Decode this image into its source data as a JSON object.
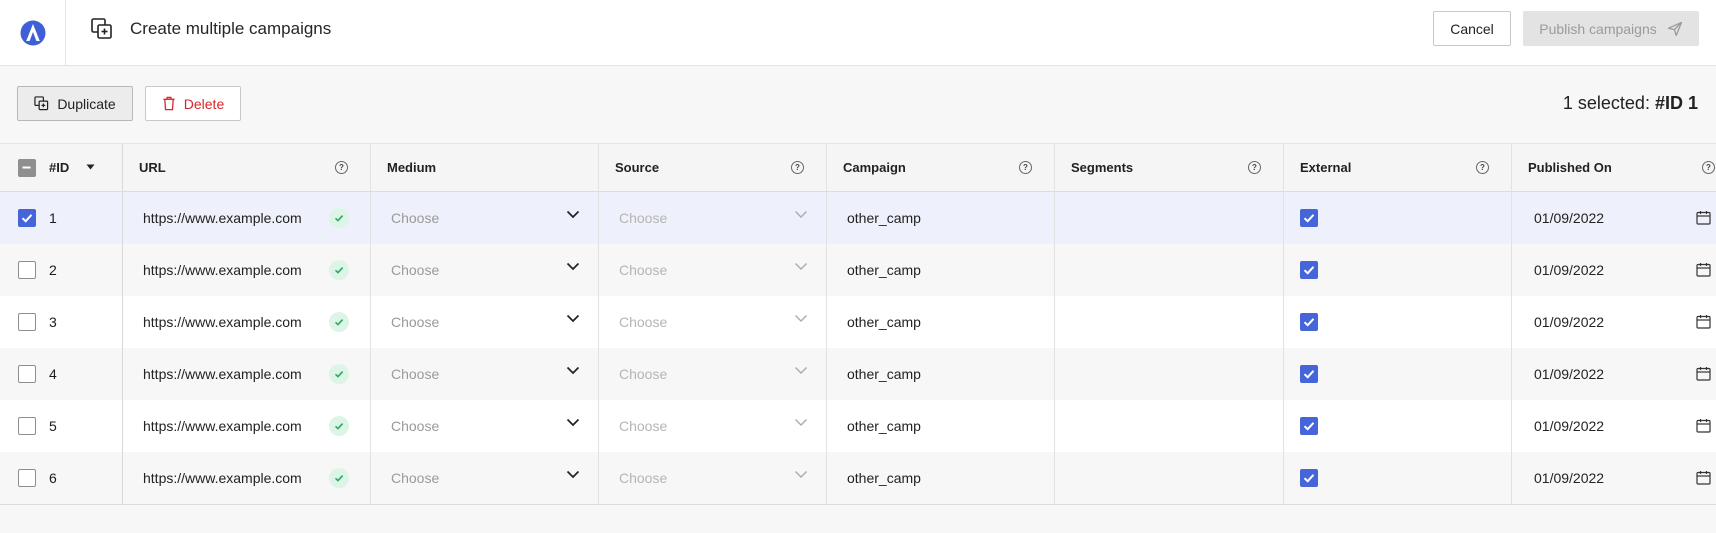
{
  "header": {
    "title": "Create multiple campaigns",
    "cancel_label": "Cancel",
    "publish_label": "Publish campaigns"
  },
  "toolbar": {
    "duplicate_label": "Duplicate",
    "delete_label": "Delete",
    "selection_prefix": "1 selected:",
    "selection_value": "#ID 1"
  },
  "table": {
    "columns": {
      "id": "#ID",
      "url": "URL",
      "medium": "Medium",
      "source": "Source",
      "campaign": "Campaign",
      "segments": "Segments",
      "external": "External",
      "published_on": "Published On"
    },
    "help_glyph": "?",
    "rows": [
      {
        "id": "1",
        "url": "https://www.example.com",
        "medium": "Choose",
        "source": "Choose",
        "campaign": "other_camp",
        "segments": "",
        "external": true,
        "published_on": "01/09/2022",
        "selected": true
      },
      {
        "id": "2",
        "url": "https://www.example.com",
        "medium": "Choose",
        "source": "Choose",
        "campaign": "other_camp",
        "segments": "",
        "external": true,
        "published_on": "01/09/2022",
        "selected": false
      },
      {
        "id": "3",
        "url": "https://www.example.com",
        "medium": "Choose",
        "source": "Choose",
        "campaign": "other_camp",
        "segments": "",
        "external": true,
        "published_on": "01/09/2022",
        "selected": false
      },
      {
        "id": "4",
        "url": "https://www.example.com",
        "medium": "Choose",
        "source": "Choose",
        "campaign": "other_camp",
        "segments": "",
        "external": true,
        "published_on": "01/09/2022",
        "selected": false
      },
      {
        "id": "5",
        "url": "https://www.example.com",
        "medium": "Choose",
        "source": "Choose",
        "campaign": "other_camp",
        "segments": "",
        "external": true,
        "published_on": "01/09/2022",
        "selected": false
      },
      {
        "id": "6",
        "url": "https://www.example.com",
        "medium": "Choose",
        "source": "Choose",
        "campaign": "other_camp",
        "segments": "",
        "external": true,
        "published_on": "01/09/2022",
        "selected": false
      }
    ]
  },
  "colors": {
    "accent": "#4565d9",
    "danger": "#d9262c",
    "success_bg": "#dcf5e6",
    "success": "#2fa865",
    "selected_row": "#eef0fb"
  },
  "icons": {
    "logo": "logo-icon",
    "title": "duplicate-add-icon",
    "publish": "send-icon",
    "duplicate": "duplicate-icon",
    "delete": "trash-icon",
    "sort": "caret-down-icon",
    "valid": "check-icon",
    "dropdown": "chevron-down-icon",
    "calendar": "calendar-icon"
  }
}
